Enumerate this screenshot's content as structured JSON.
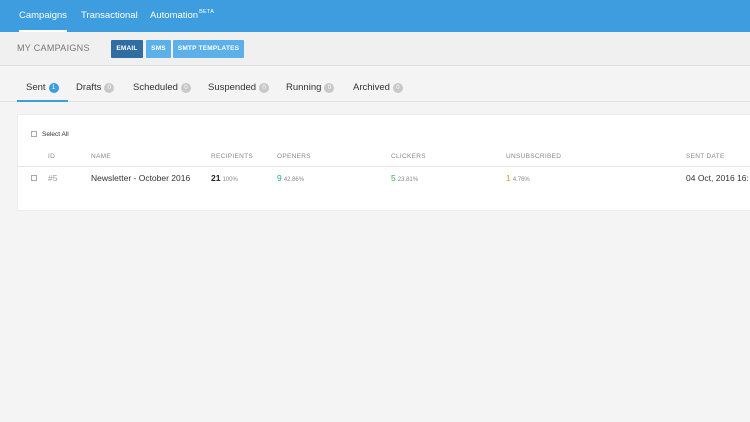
{
  "topnav": {
    "campaigns": "Campaigns",
    "transactional": "Transactional",
    "automation": "Automation",
    "automation_badge": "BETA"
  },
  "subheader": {
    "title": "MY CAMPAIGNS",
    "buttons": [
      "EMAIL",
      "SMS",
      "SMTP TEMPLATES"
    ]
  },
  "tabs": [
    {
      "label": "Sent",
      "count": "1"
    },
    {
      "label": "Drafts",
      "count": "0"
    },
    {
      "label": "Scheduled",
      "count": "0"
    },
    {
      "label": "Suspended",
      "count": "0"
    },
    {
      "label": "Running",
      "count": "0"
    },
    {
      "label": "Archived",
      "count": "0"
    }
  ],
  "table": {
    "select_all": "Select All",
    "headers": {
      "id": "ID",
      "name": "NAME",
      "recipients": "RECIPIENTS",
      "openers": "OPENERS",
      "clickers": "CLICKERS",
      "unsubscribed": "UNSUBSCRIBED",
      "sent_date": "SENT DATE"
    },
    "rows": [
      {
        "id": "#5",
        "name": "Newsletter - October 2016",
        "recipients": "21",
        "recipients_pct": "100%",
        "openers": "9",
        "openers_pct": "42.86%",
        "clickers": "5",
        "clickers_pct": "23.81%",
        "unsubscribed": "1",
        "unsubscribed_pct": "4.76%",
        "sent_date": "04 Oct, 2016 16:"
      }
    ]
  },
  "colors": {
    "nav_blue": "#3d9ddf",
    "email_button": "#2f6da3",
    "openers": "#1fa39a",
    "clickers": "#3cab4a",
    "unsubscribed": "#c9a227"
  }
}
